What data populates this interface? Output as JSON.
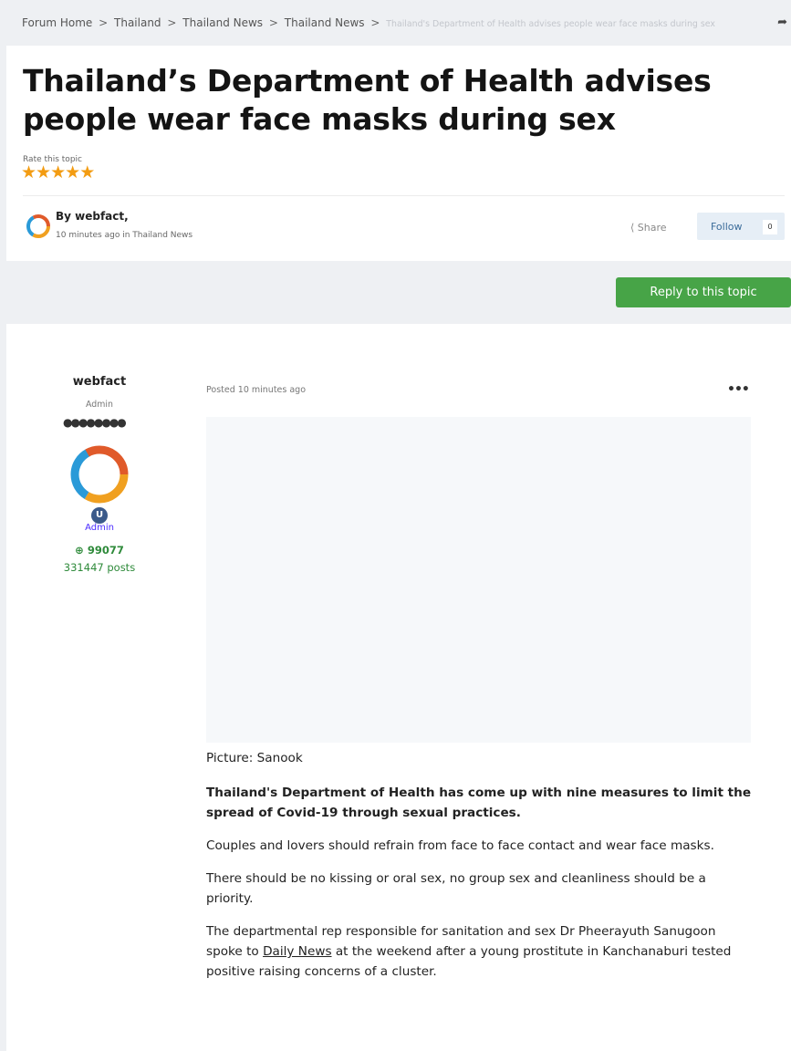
{
  "breadcrumb": {
    "items": [
      "Forum Home",
      "Thailand",
      "Thailand News",
      "Thailand News"
    ],
    "current": "Thailand's Department of Health advises people wear face masks during sex",
    "separator": ">"
  },
  "header": {
    "title": "Thailand’s Department of Health advises people wear face masks during sex",
    "rate_label": "Rate this topic",
    "rating_stars": 5,
    "author_by": "By webfact,",
    "author_meta": "10 minutes ago in Thailand News",
    "share_label": "Share",
    "follow_label": "Follow",
    "follow_count": "0"
  },
  "reply_label": "Reply to this topic",
  "post": {
    "author": {
      "name": "webfact",
      "role": "Admin",
      "group": "Admin",
      "reputation": "99077",
      "posts": "331447 posts"
    },
    "posted": "Posted 10 minutes ago",
    "caption": "Picture: Sanook",
    "lead": "Thailand's Department of Health has come up with nine measures to limit the spread of Covid-19 through sexual practices.",
    "p1": "Couples and lovers should refrain from face to face contact and wear face masks.",
    "p2": "There should be no kissing or oral sex, no group sex and cleanliness should be a priority.",
    "p3_pre": "The departmental rep responsible for sanitation and sex Dr Pheerayuth Sanugoon spoke to ",
    "p3_link": "Daily News",
    "p3_post": " at the weekend after a young prostitute in Kanchanaburi tested positive raising concerns of a cluster."
  },
  "colors": {
    "reply_button": "#47a447",
    "star": "#f39c12",
    "follow_bg": "#e6eef6",
    "reputation": "#2e8a3a"
  },
  "icons": {
    "share_top": "share-arrow-icon",
    "share": "share-icon",
    "star": "star-icon",
    "more": "more-dots-icon",
    "rep": "plus-circle-icon"
  }
}
